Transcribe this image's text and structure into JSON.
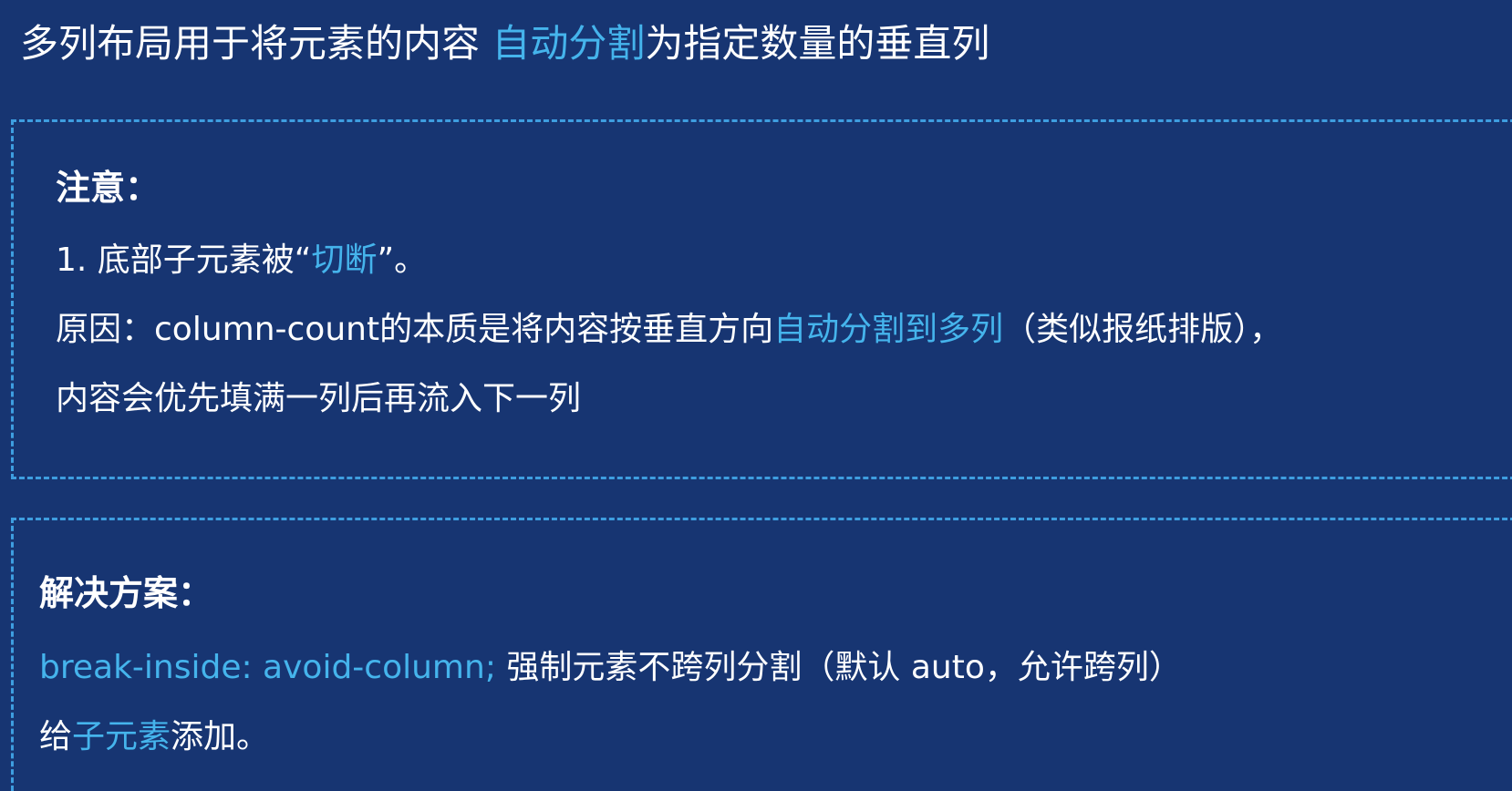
{
  "title": {
    "before": "多列布局用于将元素的内容 ",
    "highlight": "自动分割",
    "after": "为指定数量的垂直列"
  },
  "note": {
    "heading": "注意：",
    "item1_prefix": "1. 底部子元素被“",
    "item1_highlight": "切断",
    "item1_suffix": "”。",
    "reason_prefix": "原因：column-count的本质是将内容按垂直方向",
    "reason_highlight": "自动分割到多列",
    "reason_suffix": "（类似报纸排版），",
    "reason_continued": "内容会优先填满一列后再流入下一列"
  },
  "solution": {
    "heading": "解决方案：",
    "code": "break-inside: avoid-column;",
    "code_desc": " 强制元素不跨列分割（默认 auto，允许跨列）",
    "apply_prefix": "给",
    "apply_highlight": "子元素",
    "apply_suffix": "添加。"
  },
  "colors": {
    "background": "#173572",
    "highlight": "#45b4ec",
    "dashed_border": "#3e9ee0",
    "text": "#ffffff"
  }
}
